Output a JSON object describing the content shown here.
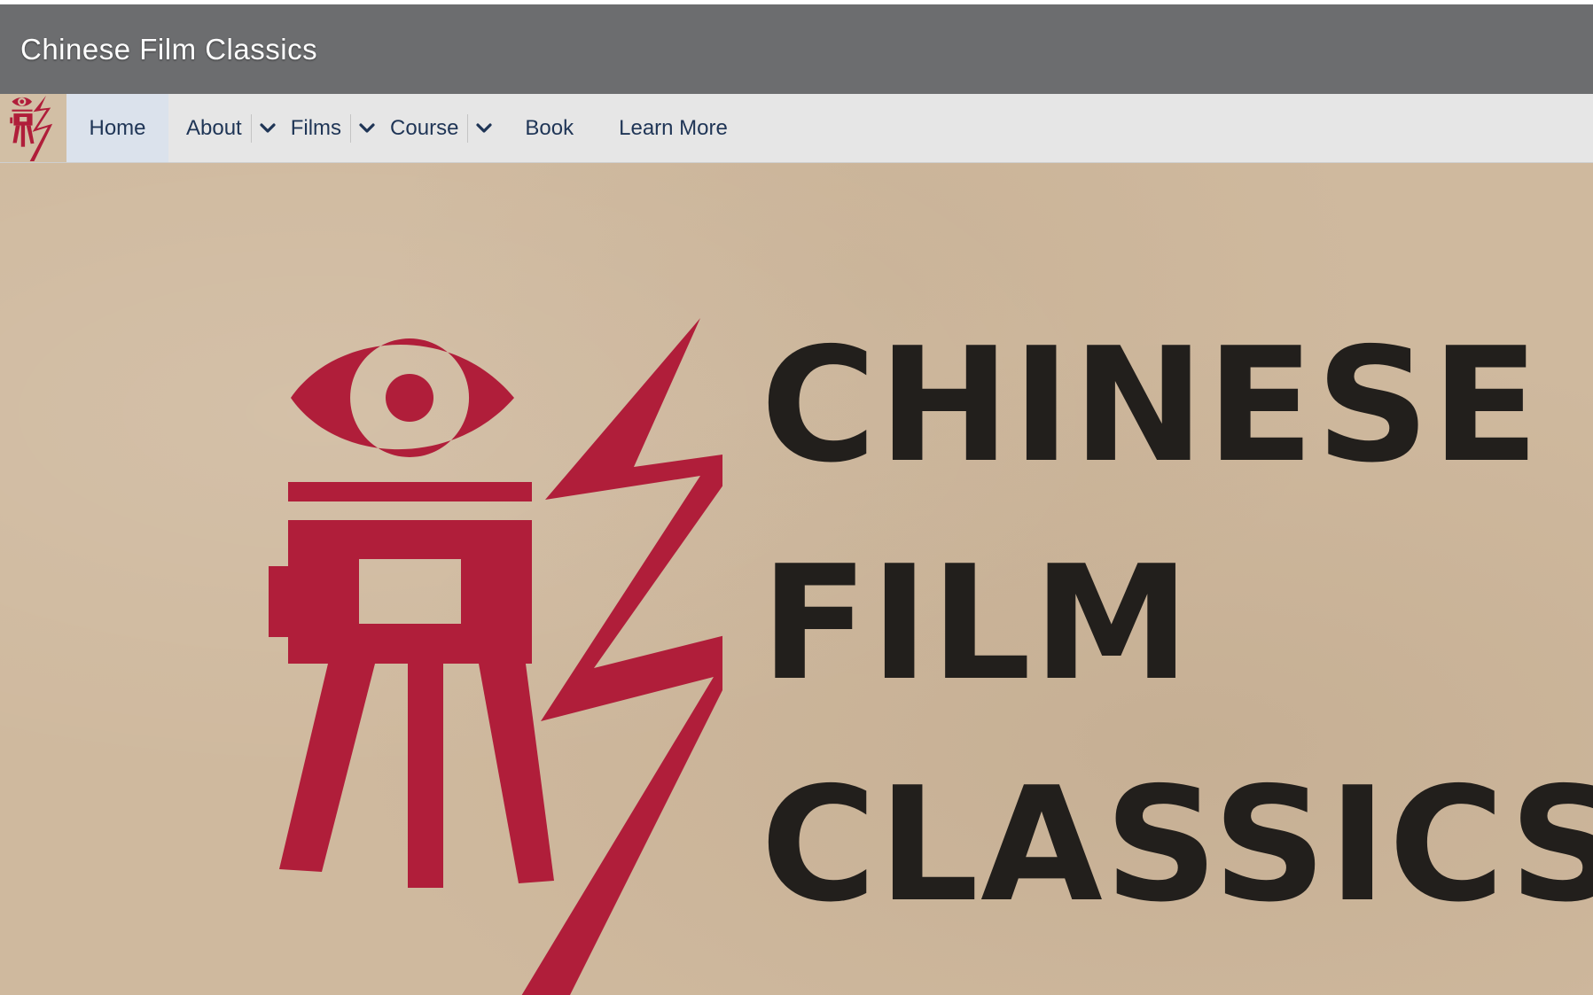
{
  "header": {
    "site_title": "Chinese Film Classics"
  },
  "nav": {
    "items": [
      {
        "label": "Home",
        "active": true
      },
      {
        "label": "About",
        "has_dropdown": true
      },
      {
        "label": "Films",
        "has_dropdown": true
      },
      {
        "label": "Course",
        "has_dropdown": true
      },
      {
        "label": "Book"
      },
      {
        "label": "Learn More"
      }
    ]
  },
  "hero": {
    "wordmark_lines": [
      "CHINESE",
      "FILM",
      "CLASSICS"
    ]
  },
  "colors": {
    "title_bar": "#6c6d6f",
    "nav_bar": "#e6e6e6",
    "nav_text": "#1f3556",
    "hero_background": "#cfb99e",
    "logo_red": "#b01e3a",
    "wordmark_dark": "#221f1c"
  },
  "icons": {
    "logo": "camera-eye-lightning-logo-icon",
    "dropdown": "chevron-down-icon"
  }
}
